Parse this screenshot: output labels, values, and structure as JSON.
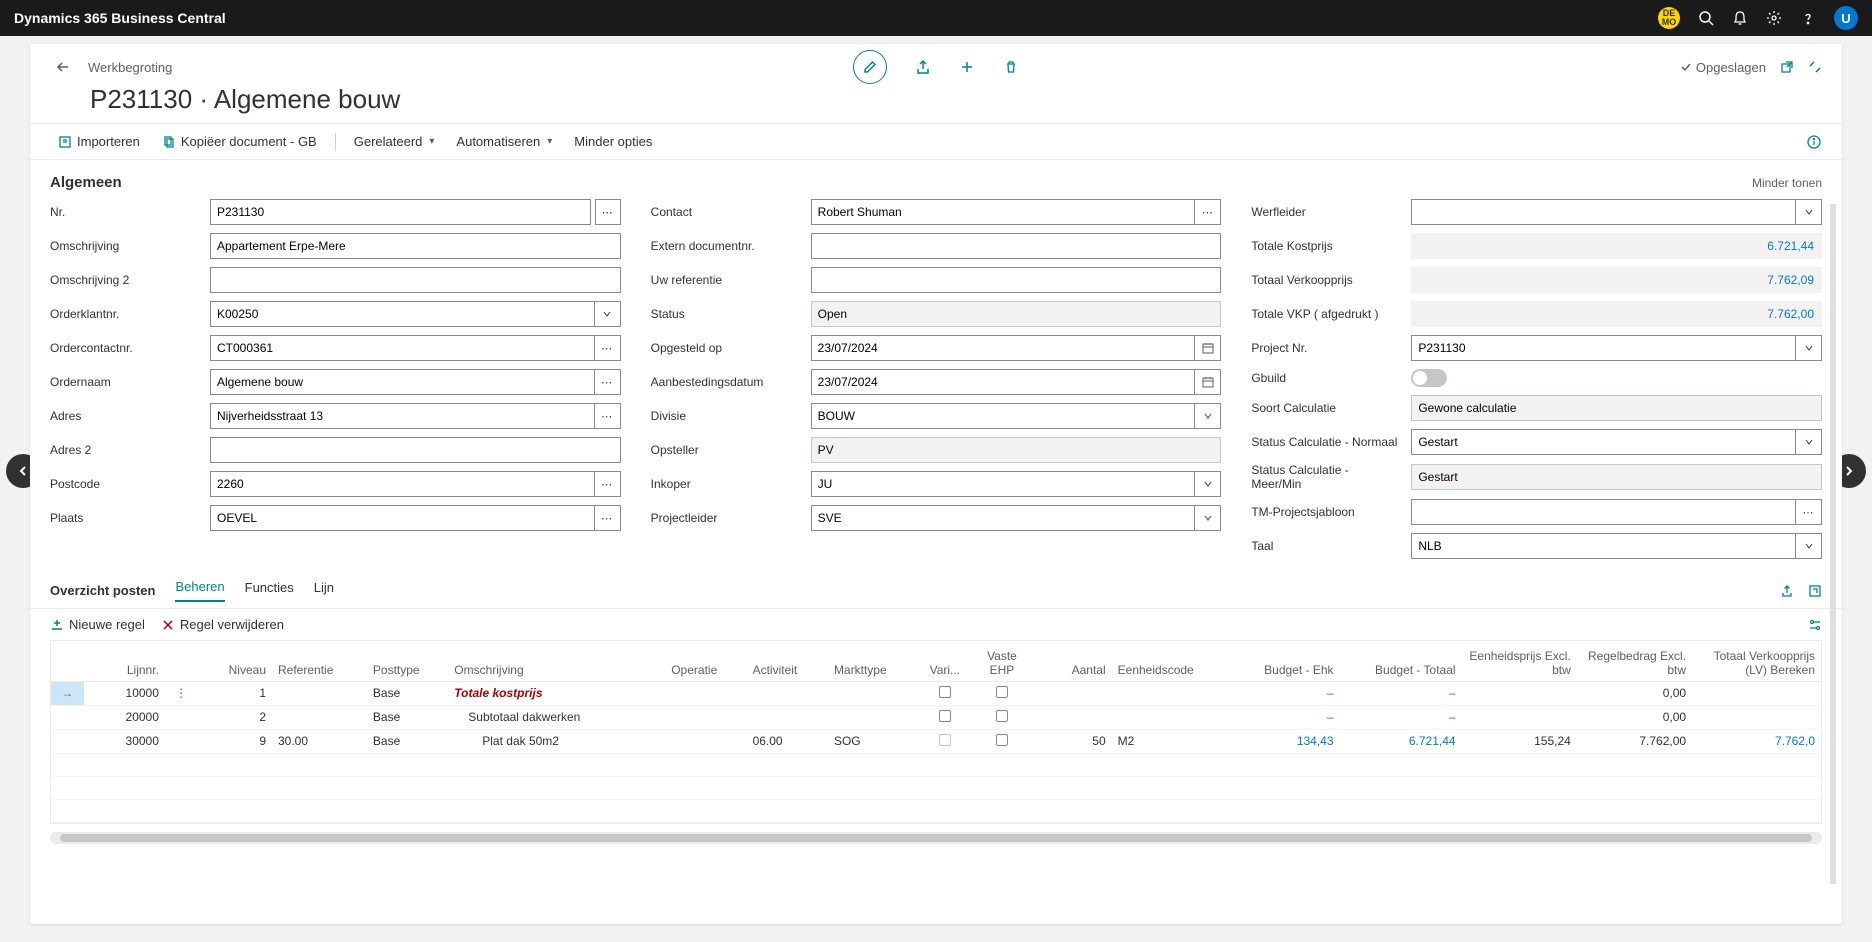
{
  "app": {
    "name": "Dynamics 365 Business Central",
    "demo_badge": "DE\nMO",
    "user_initial": "U"
  },
  "header": {
    "breadcrumb": "Werkbegroting",
    "title": "P231130 · Algemene bouw",
    "saved": "Opgeslagen"
  },
  "toolbar": {
    "import": "Importeren",
    "copy_doc": "Kopiëer document - GB",
    "related": "Gerelateerd",
    "automate": "Automatiseren",
    "fewer_options": "Minder opties"
  },
  "section": {
    "title": "Algemeen",
    "show_less": "Minder tonen"
  },
  "form": {
    "nr": {
      "label": "Nr.",
      "value": "P231130"
    },
    "omschrijving": {
      "label": "Omschrijving",
      "value": "Appartement Erpe-Mere"
    },
    "omschrijving2": {
      "label": "Omschrijving 2",
      "value": ""
    },
    "orderklant": {
      "label": "Orderklantnr.",
      "value": "K00250"
    },
    "ordercontact": {
      "label": "Ordercontactnr.",
      "value": "CT000361"
    },
    "ordernaam": {
      "label": "Ordernaam",
      "value": "Algemene bouw"
    },
    "adres": {
      "label": "Adres",
      "value": "Nijverheidsstraat 13"
    },
    "adres2": {
      "label": "Adres 2",
      "value": ""
    },
    "postcode": {
      "label": "Postcode",
      "value": "2260"
    },
    "plaats": {
      "label": "Plaats",
      "value": "OEVEL"
    },
    "contact": {
      "label": "Contact",
      "value": "Robert Shuman"
    },
    "externdoc": {
      "label": "Extern documentnr.",
      "value": ""
    },
    "uwref": {
      "label": "Uw referentie",
      "value": ""
    },
    "status": {
      "label": "Status",
      "value": "Open"
    },
    "opgesteld": {
      "label": "Opgesteld op",
      "value": "23/07/2024"
    },
    "aanbesteding": {
      "label": "Aanbestedingsdatum",
      "value": "23/07/2024"
    },
    "divisie": {
      "label": "Divisie",
      "value": "BOUW"
    },
    "opsteller": {
      "label": "Opsteller",
      "value": "PV"
    },
    "inkoper": {
      "label": "Inkoper",
      "value": "JU"
    },
    "projectleider": {
      "label": "Projectleider",
      "value": "SVE"
    },
    "werfleider": {
      "label": "Werfleider",
      "value": ""
    },
    "totale_kostprijs": {
      "label": "Totale Kostprijs",
      "value": "6.721,44"
    },
    "totaal_verkoop": {
      "label": "Totaal Verkoopprijs",
      "value": "7.762,09"
    },
    "totale_vkp": {
      "label": "Totale VKP ( afgedrukt )",
      "value": "7.762,00"
    },
    "projectnr": {
      "label": "Project Nr.",
      "value": "P231130"
    },
    "gbuild": {
      "label": "Gbuild"
    },
    "soortcalc": {
      "label": "Soort Calculatie",
      "value": "Gewone calculatie"
    },
    "statuscalc_n": {
      "label": "Status Calculatie - Normaal",
      "value": "Gestart"
    },
    "statuscalc_m": {
      "label": "Status Calculatie - Meer/Min",
      "value": "Gestart"
    },
    "tmproj": {
      "label": "TM-Projectsjabloon",
      "value": ""
    },
    "taal": {
      "label": "Taal",
      "value": "NLB"
    }
  },
  "lines": {
    "section_title": "Overzicht posten",
    "tabs": {
      "beheren": "Beheren",
      "functies": "Functies",
      "lijn": "Lijn"
    },
    "toolbar": {
      "new_line": "Nieuwe regel",
      "delete_line": "Regel verwijderen"
    },
    "columns": {
      "lijnnr": "Lijnnr.",
      "niveau": "Niveau",
      "referentie": "Referentie",
      "posttype": "Posttype",
      "omschrijving": "Omschrijving",
      "operatie": "Operatie",
      "activiteit": "Activiteit",
      "markttype": "Markttype",
      "vari": "Vari...",
      "vaste_ehp": "Vaste EHP",
      "aantal": "Aantal",
      "eenheidscode": "Eenheidscode",
      "budget_ehk": "Budget - Ehk",
      "budget_totaal": "Budget - Totaal",
      "eenheidsprijs": "Eenheidsprijs Excl. btw",
      "regelbedrag": "Regelbedrag Excl. btw",
      "totaal_verkoop": "Totaal Verkoopprijs (LV) Bereken"
    },
    "rows": [
      {
        "lijnnr": "10000",
        "niveau": "1",
        "referentie": "",
        "posttype": "Base",
        "omschrijving": "Totale kostprijs",
        "operatie": "",
        "activiteit": "",
        "markttype": "",
        "vari": false,
        "vaste": false,
        "aantal": "",
        "eenheid": "",
        "budget_ehk": "–",
        "budget_tot": "–",
        "ehp": "",
        "regelbedrag": "0,00",
        "totvkp": "",
        "style": "red-bold",
        "selected": true
      },
      {
        "lijnnr": "20000",
        "niveau": "2",
        "referentie": "",
        "posttype": "Base",
        "omschrijving": "Subtotaal dakwerken",
        "operatie": "",
        "activiteit": "",
        "markttype": "",
        "vari": false,
        "vaste": false,
        "aantal": "",
        "eenheid": "",
        "budget_ehk": "–",
        "budget_tot": "–",
        "ehp": "",
        "regelbedrag": "0,00",
        "totvkp": "",
        "style": "",
        "indent": 1
      },
      {
        "lijnnr": "30000",
        "niveau": "9",
        "referentie": "30.00",
        "posttype": "Base",
        "omschrijving": "Plat dak 50m2",
        "operatie": "",
        "activiteit": "06.00",
        "markttype": "SOG",
        "vari": true,
        "vaste": false,
        "aantal": "50",
        "eenheid": "M2",
        "budget_ehk": "134,43",
        "budget_tot": "6.721,44",
        "ehp": "155,24",
        "regelbedrag": "7.762,00",
        "totvkp": "7.762,0",
        "style": "",
        "indent": 2,
        "vari_muted": true
      }
    ]
  }
}
